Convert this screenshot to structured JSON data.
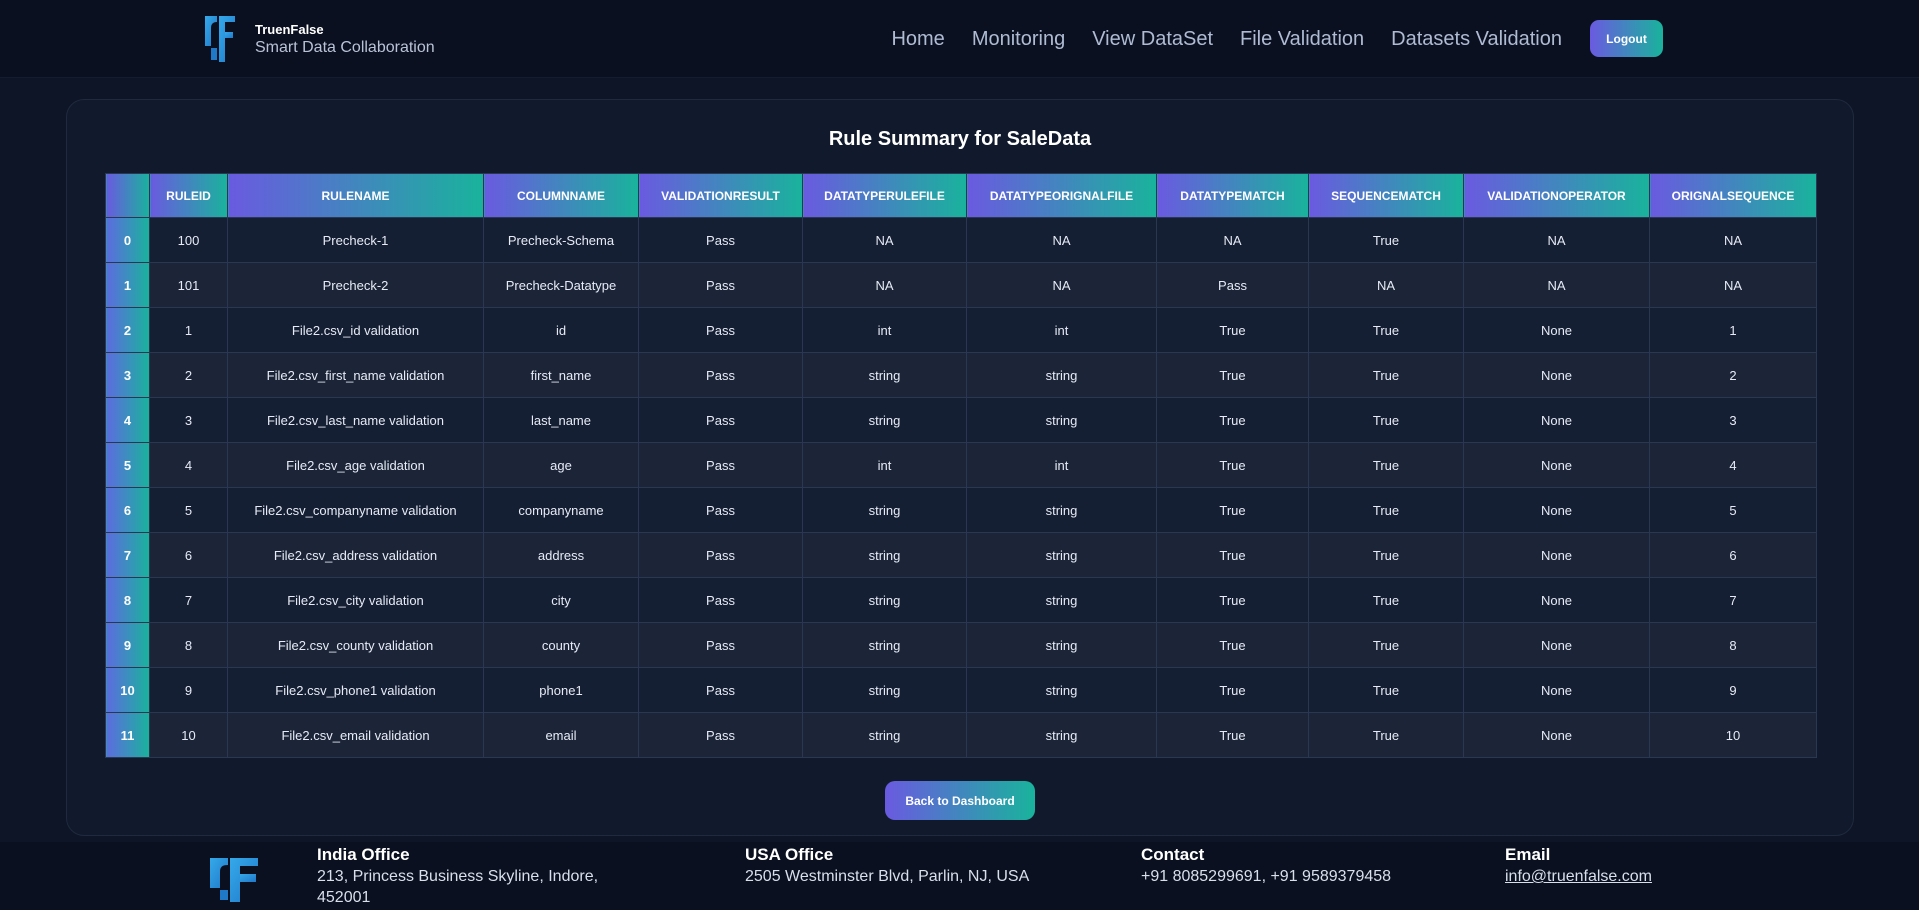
{
  "header": {
    "brand_name": "TruenFalse",
    "brand_tagline": "Smart Data Collaboration",
    "nav": [
      "Home",
      "Monitoring",
      "View DataSet",
      "File Validation",
      "Datasets Validation"
    ],
    "logout_label": "Logout"
  },
  "page": {
    "title": "Rule Summary for SaleData",
    "back_label": "Back to Dashboard"
  },
  "table": {
    "columns": [
      "",
      "RULEID",
      "RULENAME",
      "COLUMNNAME",
      "VALIDATIONRESULT",
      "DATATYPERULEFILE",
      "DATATYPEORIGNALFILE",
      "DATATYPEMATCH",
      "SEQUENCEMATCH",
      "VALIDATIONOPERATOR",
      "ORIGNALSEQUENCE"
    ],
    "rows": [
      [
        "0",
        "100",
        "Precheck-1",
        "Precheck-Schema",
        "Pass",
        "NA",
        "NA",
        "NA",
        "True",
        "NA",
        "NA"
      ],
      [
        "1",
        "101",
        "Precheck-2",
        "Precheck-Datatype",
        "Pass",
        "NA",
        "NA",
        "Pass",
        "NA",
        "NA",
        "NA"
      ],
      [
        "2",
        "1",
        "File2.csv_id validation",
        "id",
        "Pass",
        "int",
        "int",
        "True",
        "True",
        "None",
        "1"
      ],
      [
        "3",
        "2",
        "File2.csv_first_name validation",
        "first_name",
        "Pass",
        "string",
        "string",
        "True",
        "True",
        "None",
        "2"
      ],
      [
        "4",
        "3",
        "File2.csv_last_name validation",
        "last_name",
        "Pass",
        "string",
        "string",
        "True",
        "True",
        "None",
        "3"
      ],
      [
        "5",
        "4",
        "File2.csv_age validation",
        "age",
        "Pass",
        "int",
        "int",
        "True",
        "True",
        "None",
        "4"
      ],
      [
        "6",
        "5",
        "File2.csv_companyname validation",
        "companyname",
        "Pass",
        "string",
        "string",
        "True",
        "True",
        "None",
        "5"
      ],
      [
        "7",
        "6",
        "File2.csv_address validation",
        "address",
        "Pass",
        "string",
        "string",
        "True",
        "True",
        "None",
        "6"
      ],
      [
        "8",
        "7",
        "File2.csv_city validation",
        "city",
        "Pass",
        "string",
        "string",
        "True",
        "True",
        "None",
        "7"
      ],
      [
        "9",
        "8",
        "File2.csv_county validation",
        "county",
        "Pass",
        "string",
        "string",
        "True",
        "True",
        "None",
        "8"
      ],
      [
        "10",
        "9",
        "File2.csv_phone1 validation",
        "phone1",
        "Pass",
        "string",
        "string",
        "True",
        "True",
        "None",
        "9"
      ],
      [
        "11",
        "10",
        "File2.csv_email validation",
        "email",
        "Pass",
        "string",
        "string",
        "True",
        "True",
        "None",
        "10"
      ]
    ]
  },
  "footer": {
    "india_title": "India Office",
    "india_line1": "213, Princess Business Skyline, Indore,",
    "india_line2": "452001",
    "usa_title": "USA Office",
    "usa_text": "2505 Westminster Blvd, Parlin, NJ, USA",
    "contact_title": "Contact",
    "contact_text": "+91 8085299691, +91 9589379458",
    "email_title": "Email",
    "email_text": "info@truenfalse.com"
  },
  "colors": {
    "accent_start": "#6a5ae0",
    "accent_end": "#19b39c",
    "background": "#0d1526",
    "logo": "#2f9be0"
  },
  "icons": {
    "brand_logo": "truenfalse-logo-icon",
    "footer_logo": "truenfalse-logo-icon"
  }
}
